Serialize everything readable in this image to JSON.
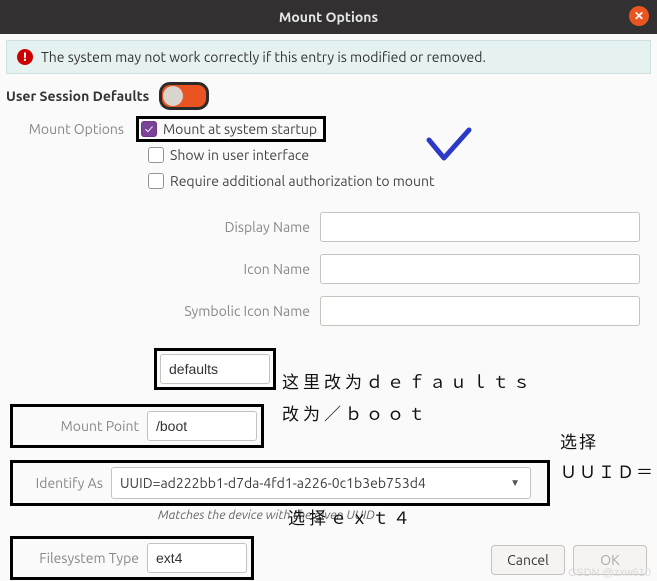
{
  "title": "Mount Options",
  "warning": "The system may not work correctly if this entry is modified or removed.",
  "section_header": "User Session Defaults",
  "session_switch_on": false,
  "options_label": "Mount Options",
  "checkboxes": {
    "startup": {
      "label": "Mount at system startup",
      "checked": true
    },
    "ui": {
      "label": "Show in user interface",
      "checked": false
    },
    "auth": {
      "label": "Require additional authorization to mount",
      "checked": false
    }
  },
  "fields": {
    "display_name": {
      "label": "Display Name",
      "value": ""
    },
    "icon_name": {
      "label": "Icon Name",
      "value": ""
    },
    "sym_icon": {
      "label": "Symbolic Icon Name",
      "value": ""
    },
    "options_str": {
      "label": "",
      "value": "defaults"
    },
    "mount_point": {
      "label": "Mount Point",
      "value": "/boot"
    },
    "identify_as": {
      "label": "Identify As",
      "value": "UUID=ad222bb1-d7da-4fd1-a226-0c1b3eb753d4"
    },
    "fs_type": {
      "label": "Filesystem Type",
      "value": "ext4"
    }
  },
  "identify_hint": "Matches the device with the given UUID",
  "buttons": {
    "cancel": "Cancel",
    "ok": "OK"
  },
  "annotations": {
    "a1": "这里改为ｄｅｆａｕｌｔｓ",
    "a2": "改为／ｂｏｏｔ",
    "a3a": "选择",
    "a3b": "ＵＵＩＤ＝．．．",
    "a4": "选择ｅｘｔ４"
  },
  "watermark": "CSDN @zxw610"
}
